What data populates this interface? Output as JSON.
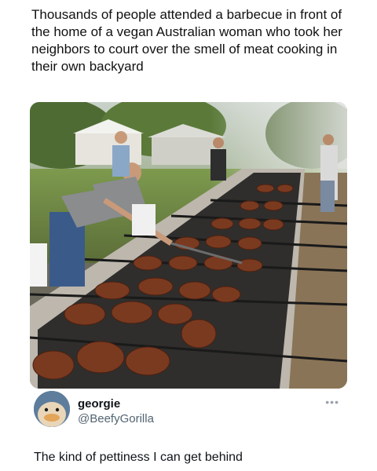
{
  "post": {
    "headline": "Thousands of people attended a barbecue in front of the home of a vegan Australian woman who took her neighbors to court over the smell of meat cooking in their own backyard",
    "photo_icon": "bbq-photo"
  },
  "tweet": {
    "display_name": "georgie",
    "handle": "@BeefyGorilla",
    "more_label": "•••",
    "text": "The kind of pettiness I can get behind",
    "avatar_icon": "duck-avatar"
  }
}
